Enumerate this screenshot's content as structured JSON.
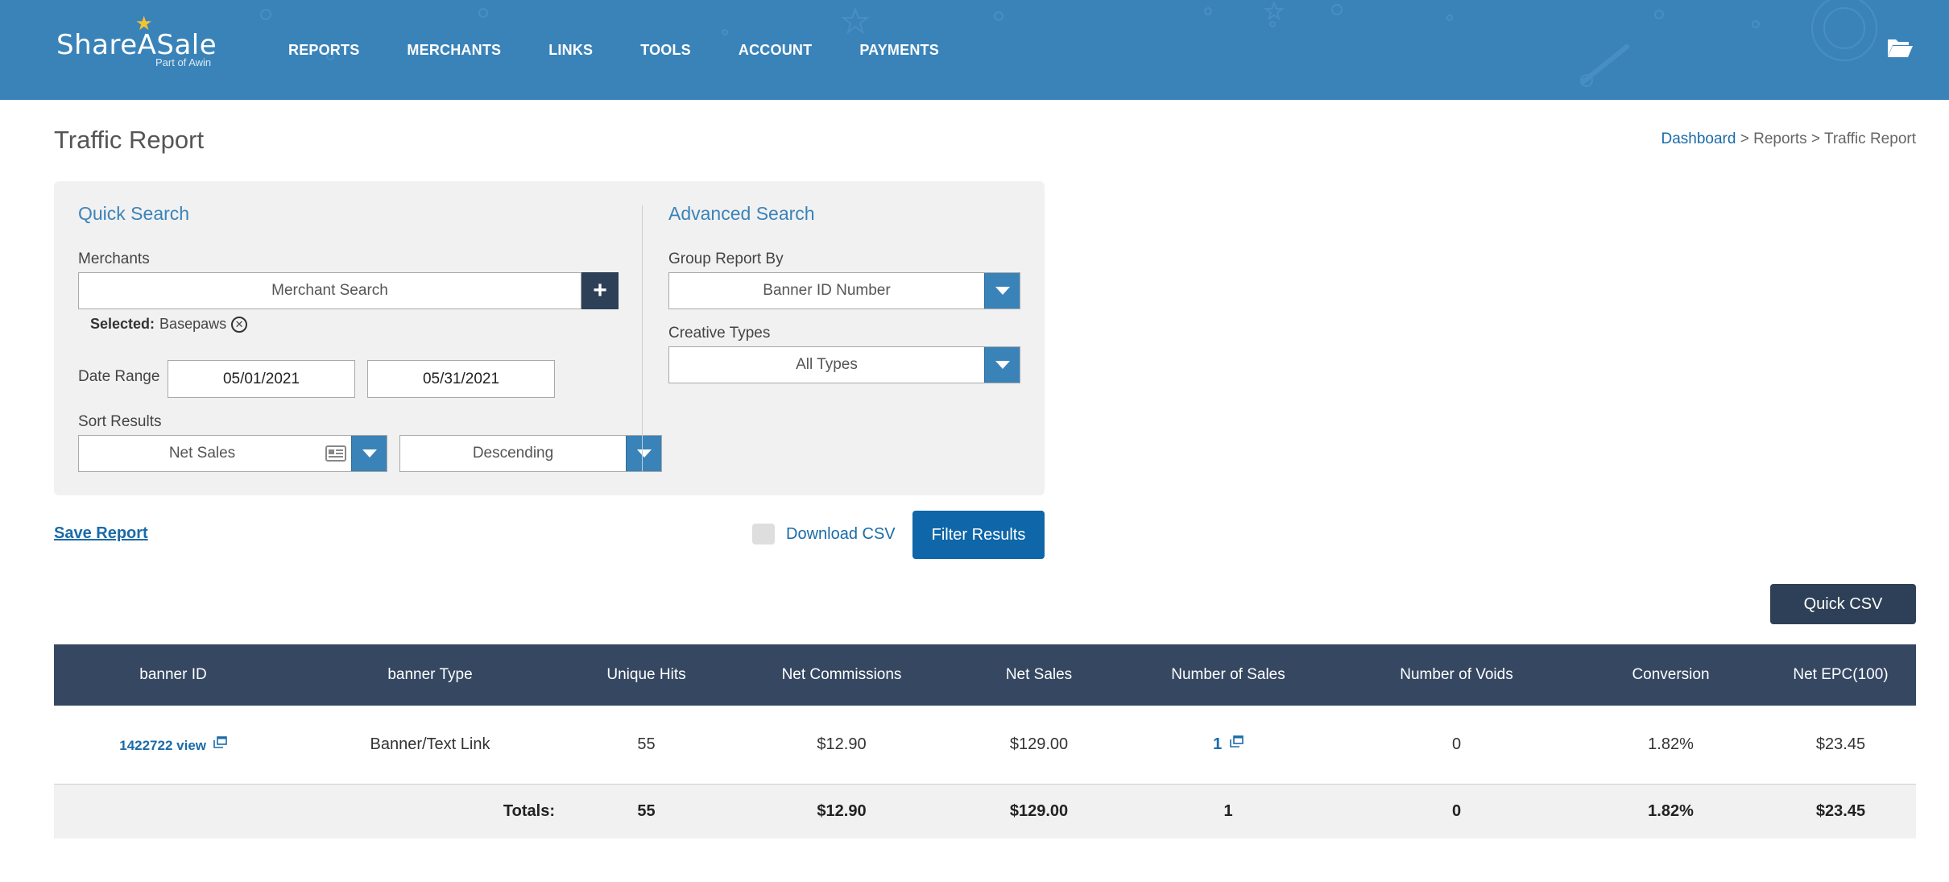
{
  "brand": {
    "name": "ShareASale",
    "sub": "Part of Awin",
    "colors": {
      "header": "#3a83b9",
      "dark": "#354761",
      "button": "#0f66a8",
      "link": "#1a6ba8"
    }
  },
  "nav": {
    "items": [
      "REPORTS",
      "MERCHANTS",
      "LINKS",
      "TOOLS",
      "ACCOUNT",
      "PAYMENTS"
    ],
    "right_icon": "folder-open-icon"
  },
  "page": {
    "title": "Traffic Report"
  },
  "breadcrumb": {
    "items": [
      "Dashboard",
      "Reports",
      "Traffic Report"
    ],
    "separator": ">"
  },
  "quick_search": {
    "title": "Quick Search",
    "merchants_label": "Merchants",
    "merchant_placeholder": "Merchant Search",
    "add_icon": "plus-icon",
    "selected_label": "Selected:",
    "selected_value": "Basepaws",
    "date_range_label": "Date Range",
    "date_from": "05/01/2021",
    "date_to": "05/31/2021",
    "sort_label": "Sort Results",
    "sort_by": "Net Sales",
    "sort_order": "Descending"
  },
  "advanced_search": {
    "title": "Advanced Search",
    "group_label": "Group Report By",
    "group_value": "Banner ID Number",
    "creative_label": "Creative Types",
    "creative_value": "All Types"
  },
  "actions": {
    "save_report": "Save Report",
    "download_csv": "Download CSV",
    "download_csv_checked": false,
    "filter_results": "Filter Results",
    "quick_csv": "Quick CSV"
  },
  "table": {
    "columns": [
      "banner ID",
      "banner Type",
      "Unique Hits",
      "Net Commissions",
      "Net Sales",
      "Number of Sales",
      "Number of Voids",
      "Conversion",
      "Net EPC(100)"
    ],
    "rows": [
      {
        "banner_id": "1422722",
        "view_label": "view",
        "banner_type": "Banner/Text Link",
        "unique_hits": "55",
        "net_commissions": "$12.90",
        "net_sales": "$129.00",
        "number_of_sales": "1",
        "number_of_voids": "0",
        "conversion": "1.82%",
        "net_epc": "$23.45"
      }
    ],
    "totals": {
      "label": "Totals:",
      "unique_hits": "55",
      "net_commissions": "$12.90",
      "net_sales": "$129.00",
      "number_of_sales": "1",
      "number_of_voids": "0",
      "conversion": "1.82%",
      "net_epc": "$23.45"
    }
  }
}
